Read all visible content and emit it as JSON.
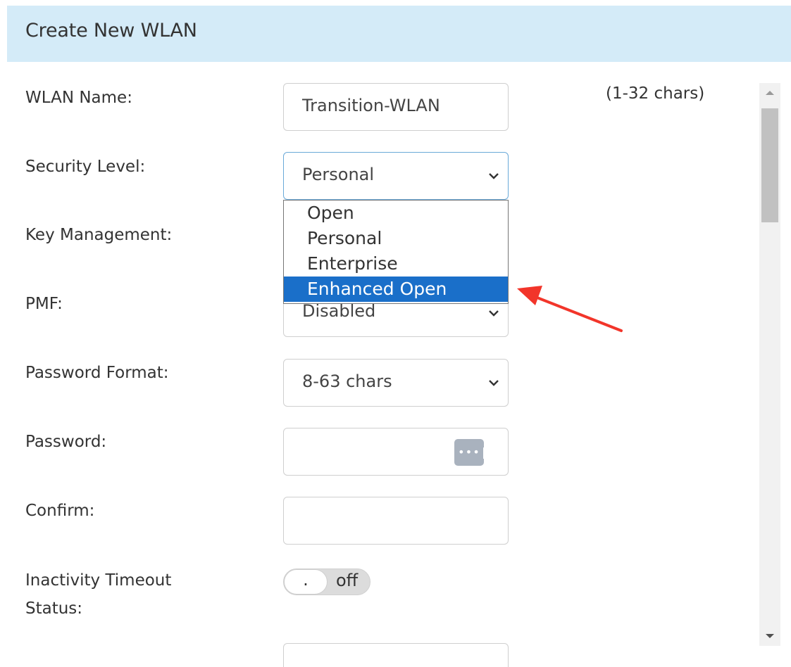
{
  "header": {
    "title": "Create New WLAN"
  },
  "form": {
    "wlan_name": {
      "label": "WLAN Name:",
      "value": "Transition-WLAN",
      "hint": "(1-32 chars)"
    },
    "security_level": {
      "label": "Security Level:",
      "value": "Personal"
    },
    "key_management": {
      "label": "Key Management:"
    },
    "pmf": {
      "label": "PMF:",
      "value": "Disabled"
    },
    "password_format": {
      "label": "Password Format:",
      "value": "8-63 chars"
    },
    "password": {
      "label": "Password:",
      "icon": "password-dots-icon",
      "icon_text": "•••|"
    },
    "confirm": {
      "label": "Confirm:"
    },
    "inactivity_timeout": {
      "label_line1": "Inactivity Timeout",
      "label_line2": "Status:",
      "knob": ".",
      "state": "off"
    }
  },
  "dropdown": {
    "options": [
      "Open",
      "Personal",
      "Enterprise",
      "Enhanced Open"
    ],
    "highlighted": "Enhanced Open"
  },
  "colors": {
    "header_bg": "#d4ebf8",
    "highlight": "#1a6fc9",
    "annotation_arrow": "#f2352a"
  }
}
